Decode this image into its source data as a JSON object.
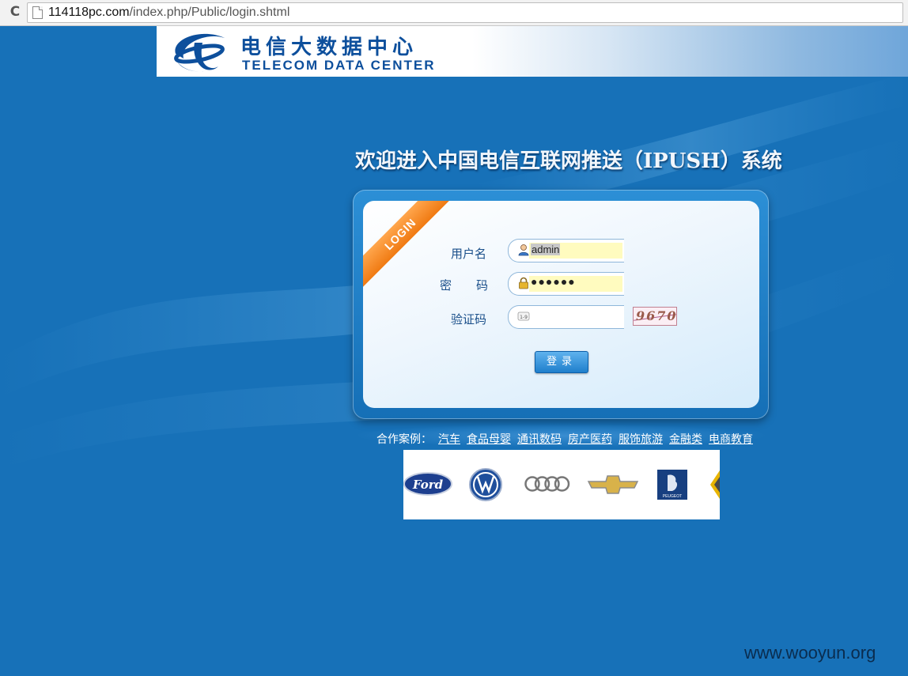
{
  "browser": {
    "url_host": "114118pc.com",
    "url_path": "/index.php/Public/login.shtml"
  },
  "header": {
    "brand_cn": "电信大数据中心",
    "brand_en": "TELECOM DATA CENTER"
  },
  "welcome_title": "欢迎进入中国电信互联网推送（IPUSH）系统",
  "login": {
    "ribbon": "LOGIN",
    "username_label": "用户名",
    "username_value": "admin",
    "password_label": "密　码",
    "password_value": "●●●●●●",
    "captcha_label": "验证码",
    "captcha_value": "",
    "captcha_image_text": "9670",
    "submit_label": "登录"
  },
  "partners": {
    "label": "合作案例：",
    "categories": [
      "汽车",
      "食品母婴",
      "通讯数码",
      "房产医药",
      "服饰旅游",
      "金融类",
      "电商教育"
    ],
    "logos": [
      "ford-logo",
      "volkswagen-logo",
      "audi-logo",
      "chevrolet-logo",
      "peugeot-logo",
      "renault-logo"
    ],
    "ford_text": "Ford",
    "peugeot_text": "PEUGEOT"
  },
  "watermark": "www.wooyun.org",
  "colors": {
    "background": "#1771b8",
    "brand_blue": "#0d4f9c",
    "ribbon_orange": "#f07a12",
    "field_autofill": "#fffbbf"
  }
}
